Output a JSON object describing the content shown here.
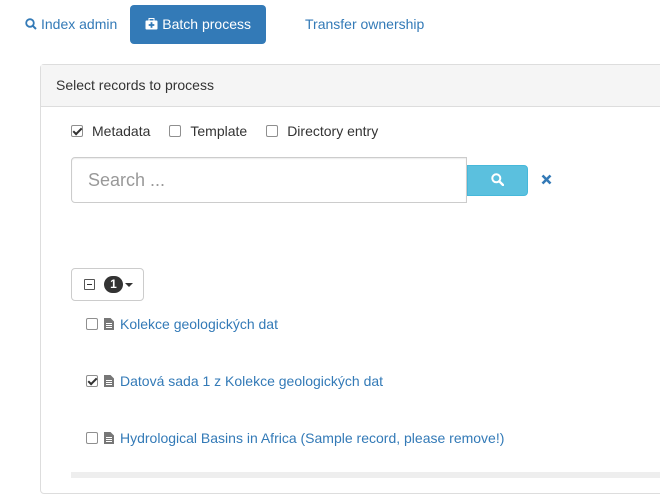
{
  "tabs": [
    {
      "label": "Index admin",
      "icon": "search-icon",
      "active": false
    },
    {
      "label": "Batch process",
      "icon": "medkit-icon",
      "active": true
    },
    {
      "label": "Transfer ownership",
      "active": false
    }
  ],
  "panel": {
    "heading": "Select records to process"
  },
  "filters": [
    {
      "label": "Metadata",
      "checked": true
    },
    {
      "label": "Template",
      "checked": false
    },
    {
      "label": "Directory entry",
      "checked": false
    }
  ],
  "search": {
    "placeholder": "Search ...",
    "value": ""
  },
  "selection": {
    "count": "1"
  },
  "records": [
    {
      "title": "Kolekce geologických dat",
      "checked": false
    },
    {
      "title": "Datová sada 1 z Kolekce geologických dat",
      "checked": true
    },
    {
      "title": "Hydrological Basins in Africa (Sample record, please remove!)",
      "checked": false
    }
  ],
  "colors": {
    "primary": "#337ab7",
    "info": "#5bc0de"
  }
}
